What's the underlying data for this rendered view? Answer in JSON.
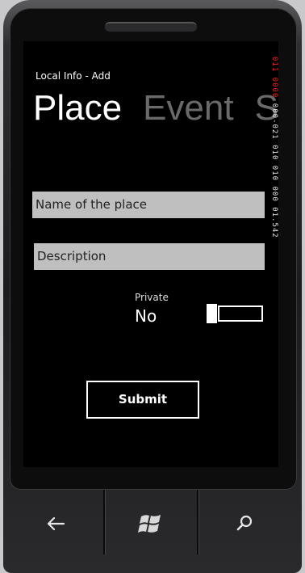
{
  "app": {
    "title": "Local Info - Add"
  },
  "pivot": {
    "items": [
      {
        "label": "Place",
        "active": true
      },
      {
        "label": "Event",
        "active": false
      },
      {
        "label": "Se",
        "active": false
      }
    ]
  },
  "form": {
    "name_placeholder": "Name of the place",
    "description_placeholder": "Description",
    "private_label": "Private",
    "private_value": "No",
    "submit_label": "Submit"
  },
  "debug": {
    "strip_red": "011 0000",
    "strip_white": "000-021 010 010 000 01.542"
  },
  "hardware": {
    "back_icon": "back-arrow-icon",
    "start_icon": "windows-logo-icon",
    "search_icon": "search-icon"
  },
  "colors": {
    "field_bg": "#bfbfbf",
    "screen_bg": "#000000",
    "inactive_pivot": "#6a6a6a"
  }
}
